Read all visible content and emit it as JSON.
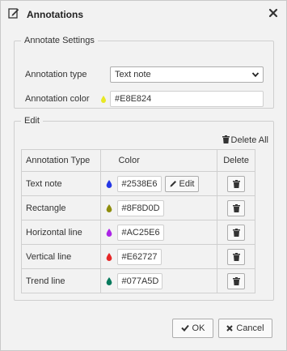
{
  "dialog": {
    "title": "Annotations",
    "title_icon": "edit-note-icon",
    "close_icon": "close-icon"
  },
  "settings": {
    "legend": "Annotate Settings",
    "type_label": "Annotation type",
    "type_value": "Text note",
    "color_label": "Annotation color",
    "color_value": "#E8E824",
    "color_swatch": "#E8E824"
  },
  "edit": {
    "legend": "Edit",
    "delete_all_label": "Delete All",
    "headers": {
      "type": "Annotation Type",
      "color": "Color",
      "delete": "Delete"
    },
    "edit_label": "Edit",
    "rows": [
      {
        "type": "Text note",
        "color": "#2538E6"
      },
      {
        "type": "Rectangle",
        "color": "#8F8D0D"
      },
      {
        "type": "Horizontal line",
        "color": "#AC25E6"
      },
      {
        "type": "Vertical line",
        "color": "#E62727"
      },
      {
        "type": "Trend line",
        "color": "#077A5D"
      }
    ]
  },
  "footer": {
    "ok_label": "OK",
    "cancel_label": "Cancel"
  }
}
